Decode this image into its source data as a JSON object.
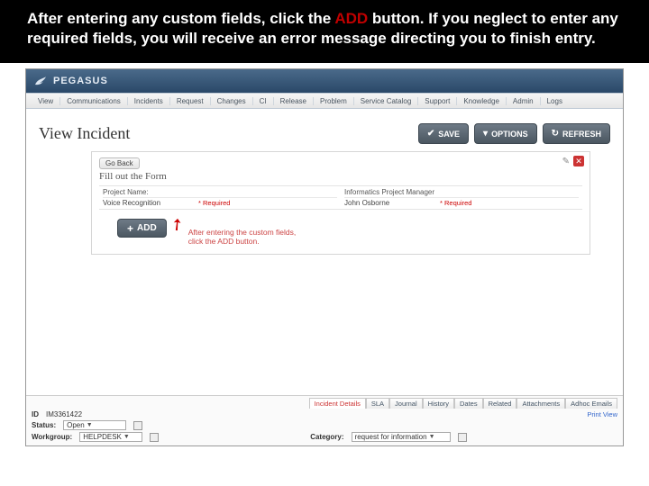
{
  "caption": {
    "before_add": "After entering any custom fields, click the ",
    "add_word": "ADD",
    "after_add": " button. If you neglect to enter any required fields, you will receive an error message directing you to finish entry."
  },
  "header": {
    "brand": "PEGASUS"
  },
  "nav": {
    "items": [
      "View",
      "Communications",
      "Incidents",
      "Request",
      "Changes",
      "CI",
      "Release",
      "Problem",
      "Service Catalog",
      "Support",
      "Knowledge",
      "Admin",
      "Logs"
    ]
  },
  "page": {
    "title": "View Incident",
    "buttons": {
      "save": "SAVE",
      "options": "OPTIONS",
      "refresh": "REFRESH"
    }
  },
  "panel": {
    "go_back": "Go Back",
    "title": "Fill out the Form",
    "fields": [
      {
        "label": "Project Name:",
        "value": "Voice Recognition",
        "required_text": "Required"
      },
      {
        "label": "Informatics Project Manager",
        "value": "John Osborne",
        "required_text": "Required"
      }
    ],
    "add_label": "ADD",
    "callout": "After entering the custom fields, click the ADD button."
  },
  "footer": {
    "id_label": "ID",
    "id_value": "IM3361422",
    "status_label": "Status:",
    "status_value": "Open",
    "workgroup_label": "Workgroup:",
    "workgroup_value": "HELPDESK",
    "category_label": "Category:",
    "category_value": "request for information",
    "print_view": "Print View",
    "tabs": [
      "Incident Details",
      "SLA",
      "Journal",
      "History",
      "Dates",
      "Related",
      "Attachments",
      "Adhoc Emails"
    ]
  }
}
